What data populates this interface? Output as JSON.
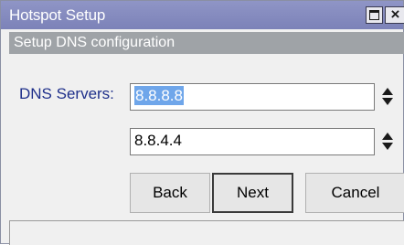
{
  "window": {
    "title": "Hotspot Setup",
    "maximize_icon": "maximize-icon",
    "close_label": "×"
  },
  "section": {
    "header": "Setup DNS configuration"
  },
  "form": {
    "dns_label": "DNS Servers:",
    "dns_primary": "8.8.8.8",
    "dns_secondary": "8.8.4.4",
    "spinner_icon": "up-down-arrows-icon"
  },
  "buttons": {
    "back": "Back",
    "next": "Next",
    "cancel": "Cancel"
  },
  "status": {
    "text": ""
  },
  "colors": {
    "titlebar": "#7c82b8",
    "section_header": "#9fa3a7",
    "label_text": "#1e2f8a",
    "selection": "#6fa6ea"
  }
}
